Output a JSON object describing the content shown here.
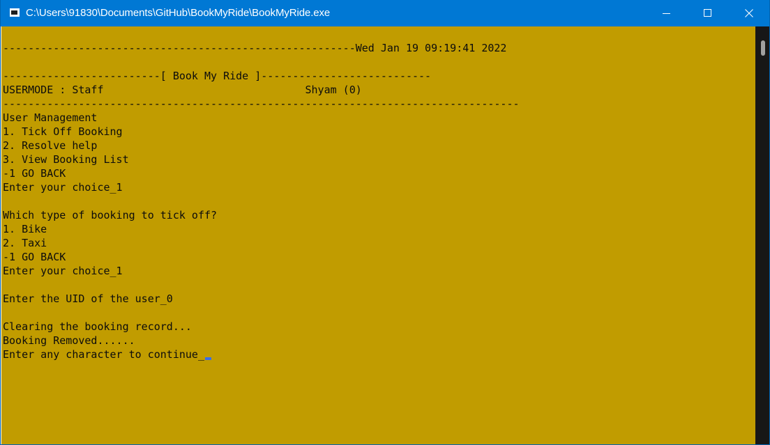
{
  "window": {
    "title": "C:\\Users\\91830\\Documents\\GitHub\\BookMyRide\\BookMyRide.exe",
    "titlebar_color": "#0078d4",
    "console_background": "#c19c00",
    "console_text_color": "#0c0c0c",
    "cursor_color": "#3a6ee8"
  },
  "controls": {
    "minimize": "minimize-icon",
    "maximize": "maximize-icon",
    "close": "close-icon"
  },
  "console": {
    "lines": [
      "",
      "--------------------------------------------------------Wed Jan 19 09:19:41 2022",
      "",
      "-------------------------[ Book My Ride ]---------------------------",
      "USERMODE : Staff                                Shyam (0)",
      "----------------------------------------------------------------------------------",
      "User Management",
      "1. Tick Off Booking",
      "2. Resolve help",
      "3. View Booking List",
      "-1 GO BACK",
      "Enter your choice_1",
      "",
      "Which type of booking to tick off?",
      "1. Bike",
      "2. Taxi",
      "-1 GO BACK",
      "Enter your choice_1",
      "",
      "Enter the UID of the user_0",
      "",
      "Clearing the booking record...",
      "Booking Removed......",
      "Enter any character to continue_"
    ]
  }
}
